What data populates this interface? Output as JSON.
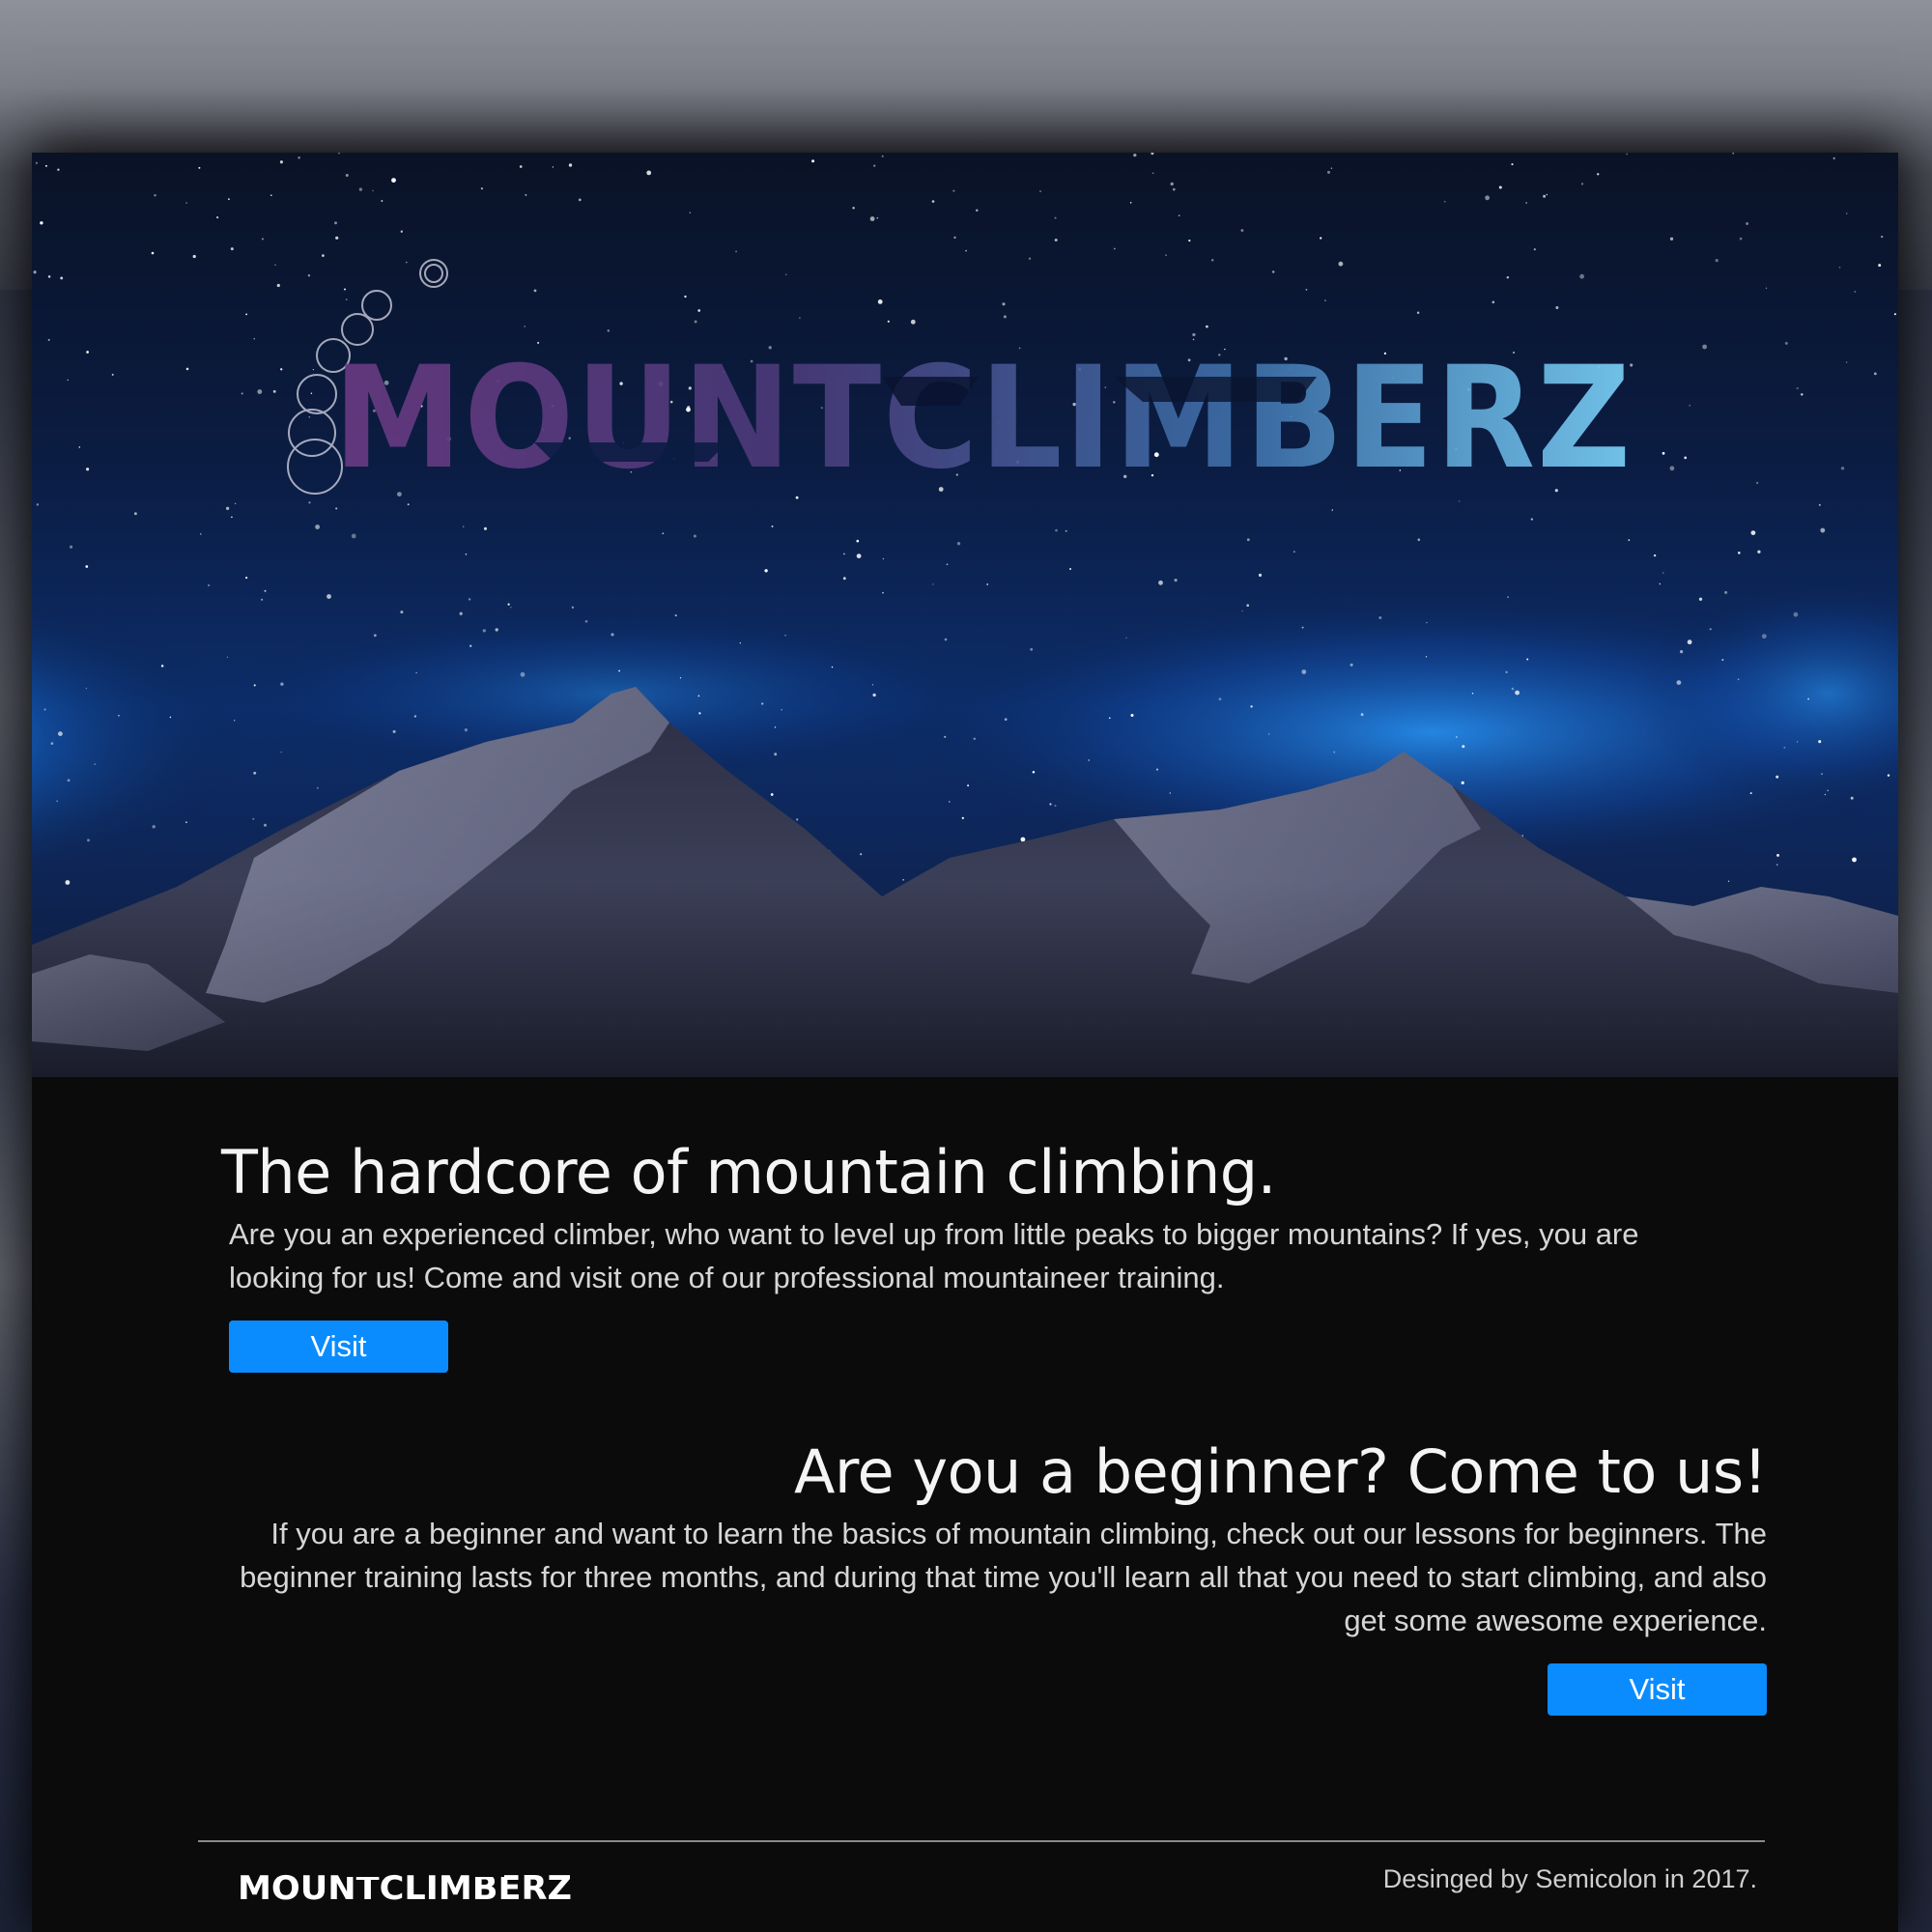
{
  "brand": {
    "name": "MOUNTCLIMBERZ"
  },
  "sections": [
    {
      "title": "The hardcore of mountain climbing.",
      "body": "Are you an experienced climber, who want to level up from little peaks to bigger mountains? If yes, you are looking for us! Come and visit one of our professional mountaineer training.",
      "button_label": "Visit"
    },
    {
      "title": "Are you a beginner? Come to us!",
      "body": "If you are a beginner and want to learn the basics of mountain climbing, check out our lessons for beginners. The beginner training lasts for three months, and during that time you'll learn all that you need to start climbing, and also get some awesome experience.",
      "button_label": "Visit"
    }
  ],
  "footer": {
    "credit": "Desinged by Semicolon in 2017."
  },
  "colors": {
    "accent": "#0a8cff",
    "background": "#0b0b0c",
    "logo_start": "#5a2f74",
    "logo_end": "#69c4f2"
  },
  "icons": [
    "bubble-decoration-icon"
  ]
}
